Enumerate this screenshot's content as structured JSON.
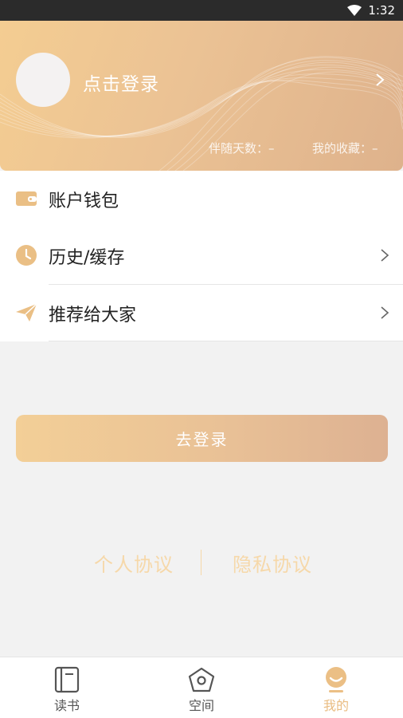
{
  "status_bar": {
    "time": "1:32"
  },
  "profile": {
    "login_text": "点击登录",
    "stats": {
      "days_label": "伴随天数：–",
      "favorites_label": "我的收藏：–"
    }
  },
  "menu": {
    "items": [
      {
        "label": "账户钱包",
        "icon": "wallet-icon",
        "has_chevron": false
      },
      {
        "label": "历史/缓存",
        "icon": "clock-icon",
        "has_chevron": true
      },
      {
        "label": "推荐给大家",
        "icon": "paper-plane-icon",
        "has_chevron": true
      }
    ]
  },
  "login_button": {
    "label": "去登录"
  },
  "agreements": {
    "personal": "个人协议",
    "privacy": "隐私协议"
  },
  "tabbar": {
    "tabs": [
      {
        "label": "读书",
        "icon": "book-icon",
        "active": false
      },
      {
        "label": "空间",
        "icon": "space-icon",
        "active": false
      },
      {
        "label": "我的",
        "icon": "profile-face-icon",
        "active": true
      }
    ]
  },
  "colors": {
    "accent": "#e9bc82",
    "header_gradient_start": "#f4cd92",
    "header_gradient_end": "#deb28c",
    "link_color": "#f6d8a9"
  }
}
